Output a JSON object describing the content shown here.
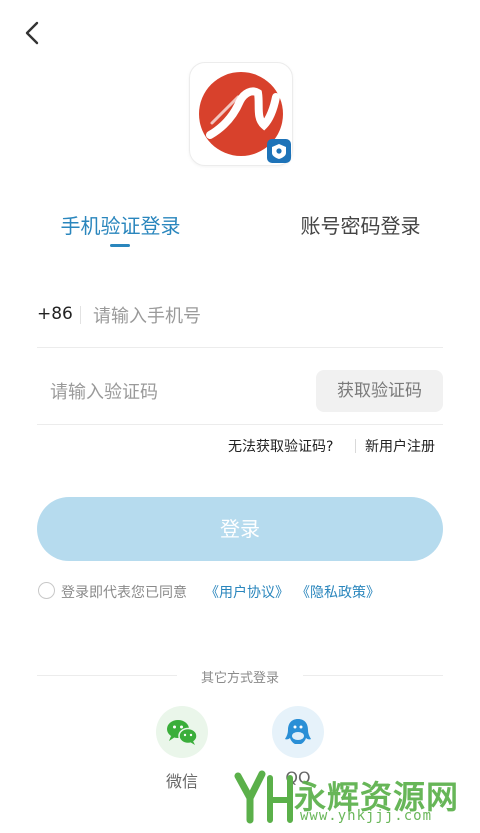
{
  "tabs": [
    {
      "label": "手机验证登录",
      "active": true
    },
    {
      "label": "账号密码登录",
      "active": false
    }
  ],
  "phone": {
    "country_code": "+86",
    "placeholder": "请输入手机号",
    "value": ""
  },
  "code": {
    "placeholder": "请输入验证码",
    "value": "",
    "get_code_label": "获取验证码"
  },
  "help_links": {
    "no_code": "无法获取验证码?",
    "register": "新用户注册"
  },
  "login_label": "登录",
  "agreement": {
    "prefix": "登录即代表您已同意",
    "user_agreement": "《用户协议》",
    "privacy_policy": "《隐私政策》",
    "checked": false
  },
  "other_login": {
    "title": "其它方式登录",
    "options": [
      {
        "label": "微信",
        "icon": "wechat-icon"
      },
      {
        "label": "QQ",
        "icon": "qq-icon"
      }
    ]
  },
  "watermark": {
    "text": "永辉资源网",
    "url": "www.yhkjjj.com"
  },
  "colors": {
    "accent": "#2a86bd",
    "login_button": "#b6dbee",
    "wechat": "#3aae3a",
    "qq": "#2a8fd6",
    "logo_red": "#d8412c"
  }
}
